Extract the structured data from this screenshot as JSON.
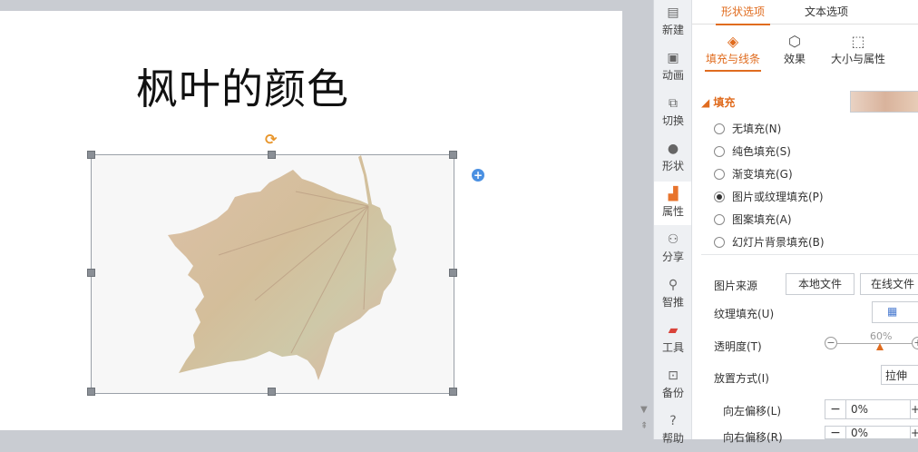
{
  "slide": {
    "title": "枫叶的颜色"
  },
  "rail": {
    "items": [
      {
        "label": "新建",
        "icon": "new-file-icon"
      },
      {
        "label": "动画",
        "icon": "animation-icon"
      },
      {
        "label": "切换",
        "icon": "transition-icon"
      },
      {
        "label": "形状",
        "icon": "shape-icon"
      },
      {
        "label": "属性",
        "icon": "property-icon"
      },
      {
        "label": "分享",
        "icon": "share-icon"
      },
      {
        "label": "智推",
        "icon": "recommend-icon"
      },
      {
        "label": "工具",
        "icon": "toolbox-icon"
      },
      {
        "label": "备份",
        "icon": "backup-icon"
      },
      {
        "label": "帮助",
        "icon": "help-icon"
      }
    ],
    "active": "属性"
  },
  "panel": {
    "top_tabs": [
      "形状选项",
      "文本选项"
    ],
    "sub_tabs": [
      "填充与线条",
      "效果",
      "大小与属性"
    ],
    "fill_section": "填充",
    "fill_options": [
      {
        "label": "无填充(N)",
        "checked": false
      },
      {
        "label": "纯色填充(S)",
        "checked": false
      },
      {
        "label": "渐变填充(G)",
        "checked": false
      },
      {
        "label": "图片或纹理填充(P)",
        "checked": true
      },
      {
        "label": "图案填充(A)",
        "checked": false
      },
      {
        "label": "幻灯片背景填充(B)",
        "checked": false
      }
    ],
    "image_source_label": "图片来源",
    "local_file_button": "本地文件",
    "online_file_button": "在线文件",
    "texture_fill_label": "纹理填充(U)",
    "transparency_label": "透明度(T)",
    "transparency_value": "60%",
    "transparency_percent": 60,
    "placement_label": "放置方式(I)",
    "placement_value": "拉伸",
    "offset_left_label": "向左偏移(L)",
    "offset_left_value": "0%",
    "offset_right_label": "向右偏移(R)",
    "offset_right_value": "0%"
  },
  "colors": {
    "accent": "#e06c1f",
    "rotate_handle": "#e8962c",
    "add_icon": "#4a90e2"
  }
}
